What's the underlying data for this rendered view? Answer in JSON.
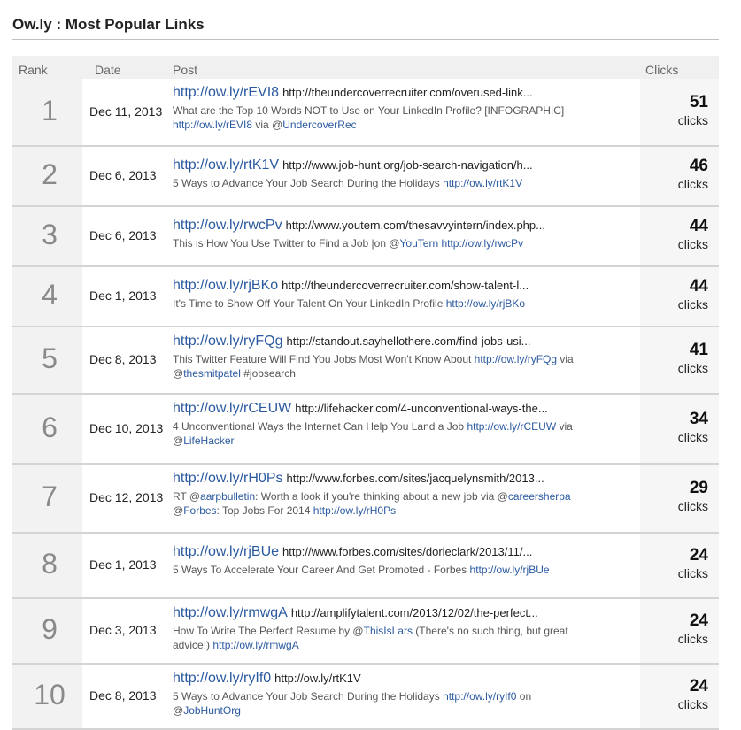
{
  "title": "Ow.ly : Most Popular Links",
  "headers": {
    "rank": "Rank",
    "date": "Date",
    "post": "Post",
    "clicks": "Clicks"
  },
  "rows": [
    {
      "rank": "1",
      "date": "Dec 11, 2013",
      "short": "http://ow.ly/rEVI8",
      "long": "http://theundercoverrecruiter.com/overused-link...",
      "desc": [
        {
          "t": "What are the Top 10 Words NOT to Use on Your LinkedIn Profile? [INFOGRAPHIC]"
        },
        {
          "br": true
        },
        {
          "t": "http://ow.ly/rEVI8",
          "link": true
        },
        {
          "t": " via @"
        },
        {
          "t": "UndercoverRec",
          "link": true
        }
      ],
      "clicks": "51",
      "clicks_label": "clicks"
    },
    {
      "rank": "2",
      "date": "Dec 6, 2013",
      "short": "http://ow.ly/rtK1V",
      "long": "http://www.job-hunt.org/job-search-navigation/h...",
      "desc": [
        {
          "t": "5 Ways to Advance Your Job Search During the Holidays "
        },
        {
          "t": "http://ow.ly/rtK1V",
          "link": true
        }
      ],
      "clicks": "46",
      "clicks_label": "clicks"
    },
    {
      "rank": "3",
      "date": "Dec 6, 2013",
      "short": "http://ow.ly/rwcPv",
      "long": "http://www.youtern.com/thesavvyintern/index.php...",
      "desc": [
        {
          "t": "This is How You Use Twitter to Find a Job |on @"
        },
        {
          "t": "YouTern",
          "link": true
        },
        {
          "t": " "
        },
        {
          "t": "http://ow.ly/rwcPv",
          "link": true
        }
      ],
      "clicks": "44",
      "clicks_label": "clicks"
    },
    {
      "rank": "4",
      "date": "Dec 1, 2013",
      "short": "http://ow.ly/rjBKo",
      "long": "http://theundercoverrecruiter.com/show-talent-l...",
      "desc": [
        {
          "t": "It's Time to Show Off Your Talent On Your LinkedIn Profile "
        },
        {
          "t": "http://ow.ly/rjBKo",
          "link": true
        }
      ],
      "clicks": "44",
      "clicks_label": "clicks"
    },
    {
      "rank": "5",
      "date": "Dec 8, 2013",
      "short": "http://ow.ly/ryFQg",
      "long": "http://standout.sayhellothere.com/find-jobs-usi...",
      "desc": [
        {
          "t": "This Twitter Feature Will Find You Jobs Most Won't Know About "
        },
        {
          "t": "http://ow.ly/ryFQg",
          "link": true
        },
        {
          "t": " via"
        },
        {
          "br": true
        },
        {
          "t": "@"
        },
        {
          "t": "thesmitpatel",
          "link": true
        },
        {
          "t": " #jobsearch"
        }
      ],
      "clicks": "41",
      "clicks_label": "clicks"
    },
    {
      "rank": "6",
      "date": "Dec 10, 2013",
      "short": "http://ow.ly/rCEUW",
      "long": "http://lifehacker.com/4-unconventional-ways-the...",
      "desc": [
        {
          "t": "4 Unconventional Ways the Internet Can Help You Land a Job "
        },
        {
          "t": "http://ow.ly/rCEUW",
          "link": true
        },
        {
          "t": " via"
        },
        {
          "br": true
        },
        {
          "t": "@"
        },
        {
          "t": "LifeHacker",
          "link": true
        }
      ],
      "clicks": "34",
      "clicks_label": "clicks"
    },
    {
      "rank": "7",
      "date": "Dec 12, 2013",
      "short": "http://ow.ly/rH0Ps",
      "long": "http://www.forbes.com/sites/jacquelynsmith/2013...",
      "desc": [
        {
          "t": "RT @"
        },
        {
          "t": "aarpbulletin",
          "link": true
        },
        {
          "t": ": Worth a look if you're thinking about a new job via @"
        },
        {
          "t": "careersherpa",
          "link": true
        },
        {
          "br": true
        },
        {
          "t": "@"
        },
        {
          "t": "Forbes",
          "link": true
        },
        {
          "t": ": Top Jobs For 2014 "
        },
        {
          "t": "http://ow.ly/rH0Ps",
          "link": true
        }
      ],
      "clicks": "29",
      "clicks_label": "clicks"
    },
    {
      "rank": "8",
      "date": "Dec 1, 2013",
      "short": "http://ow.ly/rjBUe",
      "long": "http://www.forbes.com/sites/dorieclark/2013/11/...",
      "desc": [
        {
          "t": "5 Ways To Accelerate Your Career And Get Promoted - Forbes "
        },
        {
          "t": "http://ow.ly/rjBUe",
          "link": true
        }
      ],
      "clicks": "24",
      "clicks_label": "clicks"
    },
    {
      "rank": "9",
      "date": "Dec 3, 2013",
      "short": "http://ow.ly/rmwgA",
      "long": "http://amplifytalent.com/2013/12/02/the-perfect...",
      "desc": [
        {
          "t": "How To Write The Perfect Resume by @"
        },
        {
          "t": "ThisIsLars",
          "link": true
        },
        {
          "t": " (There's no such thing, but great"
        },
        {
          "br": true
        },
        {
          "t": "advice!) "
        },
        {
          "t": "http://ow.ly/rmwgA",
          "link": true
        }
      ],
      "clicks": "24",
      "clicks_label": "clicks"
    },
    {
      "rank": "10",
      "date": "Dec 8, 2013",
      "short": "http://ow.ly/ryIf0",
      "long": "http://ow.ly/rtK1V",
      "desc": [
        {
          "t": "5 Ways to Advance Your Job Search During the Holidays  "
        },
        {
          "t": "http://ow.ly/ryIf0",
          "link": true
        },
        {
          "t": " on"
        },
        {
          "br": true
        },
        {
          "t": "@"
        },
        {
          "t": "JobHuntOrg",
          "link": true
        }
      ],
      "clicks": "24",
      "clicks_label": "clicks"
    }
  ],
  "colors": {
    "link": "#2b5aa0",
    "rank": "#8a8a8a",
    "header_bg": "#f0f0f0"
  }
}
